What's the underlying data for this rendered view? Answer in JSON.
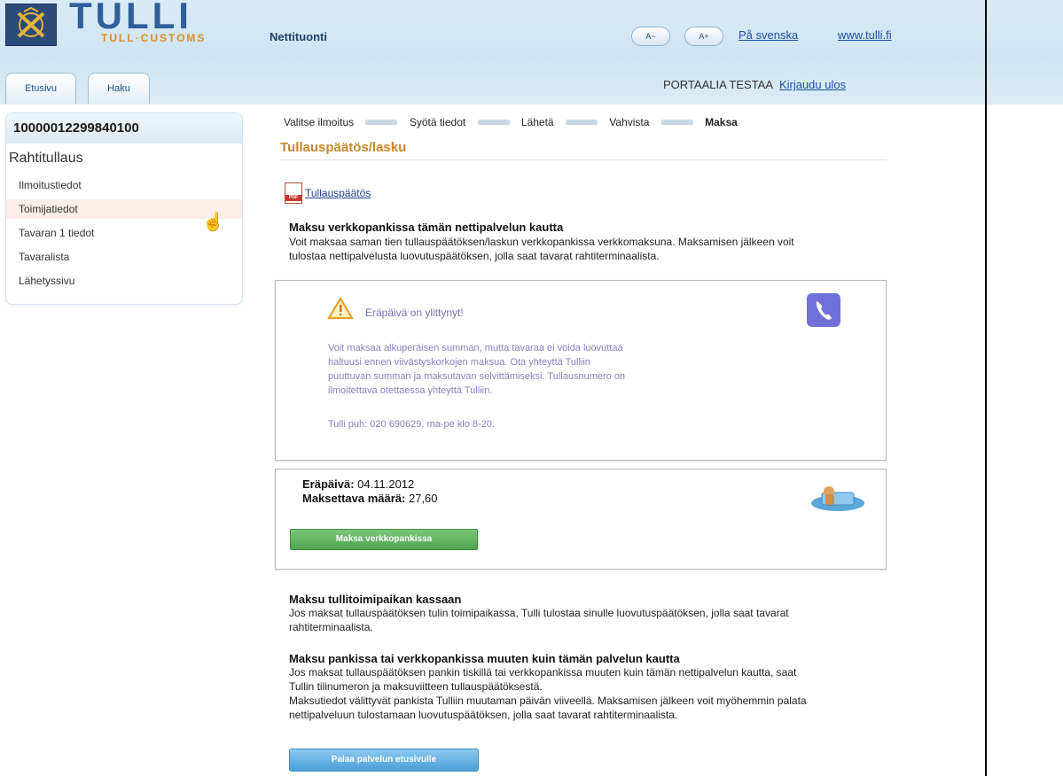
{
  "header": {
    "logo_title": "TULLI",
    "logo_subtitle": "TULL·CUSTOMS",
    "app_name": "Nettituonti",
    "font_smaller": "A−",
    "font_larger": "A+",
    "lang_link": "På svenska",
    "site_link": "www.tulli.fi",
    "tabs": [
      "Etusivu",
      "Haku"
    ],
    "user_text": "PORTAALIA TESTAA",
    "logout": "Kirjaudu ulos"
  },
  "sidebar": {
    "id": "10000012299840100",
    "section": "Rahtitullaus",
    "items": [
      "Ilmoitustiedot",
      "Toimijatiedot",
      "Tavaran 1 tiedot",
      "Tavaralista",
      "Lähetyssivu"
    ],
    "active_index": 1
  },
  "steps": [
    "Valitse ilmoitus",
    "Syötä tiedot",
    "Lähetä",
    "Vahvista",
    "Maksa"
  ],
  "main": {
    "title": "Tullauspäätös/lasku",
    "pdf_label": "PDF",
    "pdf_link": "Tullauspäätös",
    "online": {
      "heading": "Maksu verkkopankissa tämän nettipalvelun kautta",
      "lines": [
        "Voit maksaa saman tien tullauspäätöksen/laskun verkkopankissa verkkomaksuna. Maksamisen jälkeen voit",
        "tulostaa nettipalvelusta luovutuspäätöksen, jolla saat tavarat rahtiterminaalista."
      ]
    },
    "warning": {
      "title": "Eräpäivä on ylittynyt!",
      "lines": [
        "Voit maksaa alkuperäisen summan, mutta tavaraa ei voida luovuttaa",
        "haltuusi ennen viivästyskorkojen maksua. Ota yhteyttä Tulliin",
        "puuttuvan summan ja maksutavan selvittämiseksi. Tullausnumero on",
        "ilmoitettava otettaessa yhteyttä Tulliin."
      ],
      "phone": "Tulli puh: 020 690629, ma-pe klo 8-20."
    },
    "payment": {
      "due_label": "Eräpäivä:",
      "due_value": "04.11.2012",
      "amount_label": "Maksettava määrä:",
      "amount_value": "27,60",
      "button": "Maksa verkkopankissa"
    },
    "office": {
      "heading": "Maksu tullitoimipaikan kassaan",
      "lines": [
        "Jos maksat tullauspäätöksen tulin toimipaikassa, Tulli tulostaa sinulle luovutuspäätöksen, jolla saat tavarat",
        "rahtiterminaalista."
      ]
    },
    "bank": {
      "heading": "Maksu pankissa tai verkkopankissa muuten kuin tämän palvelun kautta",
      "lines": [
        "Jos maksat tullauspäätöksen pankin tiskillä tai verkkopankissa muuten kuin tämän nettipalvelun kautta, saat",
        "Tullin tilinumeron ja maksuviitteen tullauspäätöksestä.",
        "Maksutiedot välittyvät pankista Tulliin muutaman päivän viiveellä. Maksamisen jälkeen voit myöhemmin palata",
        "nettipalveluun tulostamaan luovutuspäätöksen, jolla saat tavarat rahtiterminaalista."
      ]
    },
    "back_button": "Palaa palvelun etusivulle"
  }
}
